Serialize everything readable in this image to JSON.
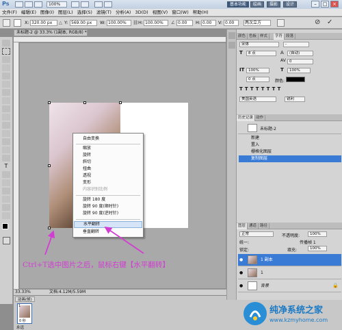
{
  "titlebar": {
    "logo": "Ps",
    "zoom": "100%",
    "workspaces": [
      "基本功能",
      "绘画",
      "摄影",
      "设计"
    ],
    "window_controls": [
      "–",
      "□",
      "×"
    ]
  },
  "menu": [
    "文件(F)",
    "编辑(E)",
    "图像(I)",
    "图层(L)",
    "选择(S)",
    "滤镜(T)",
    "分析(A)",
    "3D(D)",
    "视图(V)",
    "窗口(W)",
    "帮助(H)"
  ],
  "options": {
    "x_label": "X:",
    "x_value": "320.00 px",
    "y_label": "Y:",
    "y_value": "569.00 px",
    "w_label": "W:",
    "w_value": "100.00%",
    "h_label": "H:",
    "h_value": "100.00%",
    "angle_value": "0.00",
    "h_skew_label": "H:",
    "h_skew_value": "0.00",
    "v_skew_label": "V:",
    "v_skew_value": "0.00",
    "interp_value": "两次立方"
  },
  "doc_tab": "未标题-2 @ 33.3% (1副本, RGB/8) *",
  "context_menu": [
    {
      "label": "自由变换",
      "state": "normal"
    },
    {
      "sep": true
    },
    {
      "label": "缩放",
      "state": "normal"
    },
    {
      "label": "旋转",
      "state": "normal"
    },
    {
      "label": "斜切",
      "state": "normal"
    },
    {
      "label": "扭曲",
      "state": "normal"
    },
    {
      "label": "透视",
      "state": "normal"
    },
    {
      "label": "变形",
      "state": "normal"
    },
    {
      "label": "内容识别比例",
      "state": "disabled"
    },
    {
      "sep": true
    },
    {
      "label": "旋转 180 度",
      "state": "normal"
    },
    {
      "label": "旋转 90 度(顺时针)",
      "state": "normal"
    },
    {
      "label": "旋转 90 度(逆时针)",
      "state": "normal"
    },
    {
      "sep": true
    },
    {
      "label": "水平翻转",
      "state": "highlighted"
    },
    {
      "label": "垂直翻转",
      "state": "normal"
    }
  ],
  "annotation": "Ctrl+T选中图片之后，鼠标右键【水平翻转】",
  "annotation_color": "#d23cd2",
  "status": {
    "zoom": "33.33%",
    "doc": "文档:4.12M/5.59M"
  },
  "animation": {
    "tab": "动画(帧)",
    "frame_no": "1",
    "frame_time": "0 秒",
    "loop": "永远"
  },
  "char_panel": {
    "tabs": [
      "颜色",
      "色板",
      "样式",
      "字符",
      "段落"
    ],
    "active_tab": "字符",
    "font_family": "宋体",
    "font_style": "-",
    "size": "8 点",
    "leading": "(自动)",
    "tracking": "0",
    "scale_v": "100%",
    "scale_h": "100%",
    "baseline": "0 点",
    "color_label": "颜色:",
    "language": "美国英语",
    "aa": "锐利"
  },
  "history_panel": {
    "tabs": [
      "历史记录",
      "动作"
    ],
    "snapshot": "未标题-2",
    "items": [
      "新建",
      "置入",
      "栅格化图层",
      "复制图层"
    ],
    "selected": 3
  },
  "layers_panel": {
    "tabs": [
      "图层",
      "通道",
      "路径"
    ],
    "blend_mode": "正常",
    "opacity_label": "不透明度:",
    "opacity": "100%",
    "lock_label": "锁定:",
    "fill_label": "填充:",
    "fill": "100%",
    "unify_label": "统一:",
    "propagate_label": "传播帧 1",
    "layers": [
      {
        "name": "1 副本",
        "selected": true
      },
      {
        "name": "1",
        "selected": false
      },
      {
        "name": "背景",
        "selected": false
      }
    ]
  },
  "watermark": {
    "title": "纯净系统之家",
    "url": "www.kzmyhome.com"
  }
}
